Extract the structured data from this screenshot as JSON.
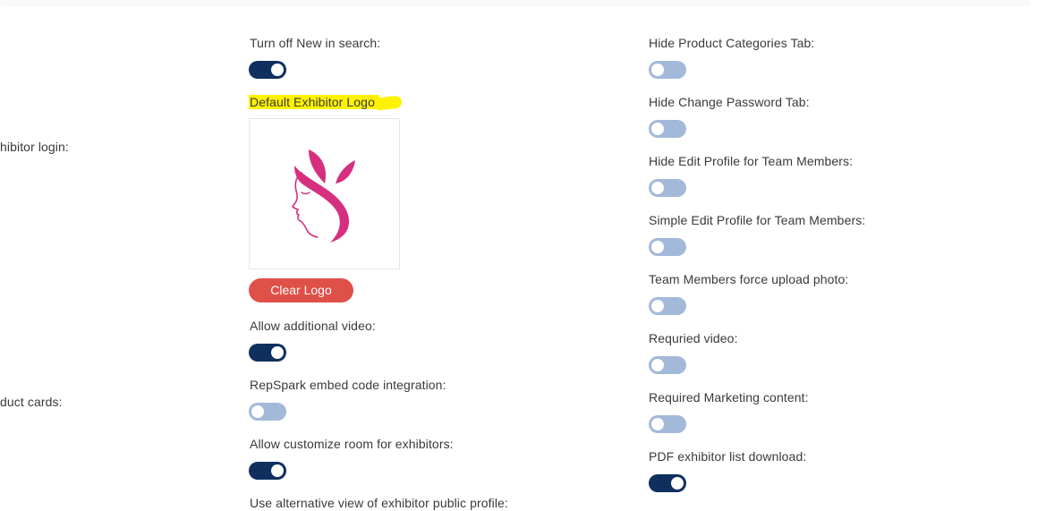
{
  "left_column": {
    "exhibitor_login_label": "hibitor login:",
    "product_cards_label": "duct cards:"
  },
  "middle_column": {
    "turn_off_new_label": "Turn off New in search:",
    "turn_off_new_on": true,
    "default_logo_label": "Default Exhibitor Logo:",
    "clear_logo_button": "Clear Logo",
    "allow_video_label": "Allow additional video:",
    "allow_video_on": true,
    "repspark_label": "RepSpark embed code integration:",
    "repspark_on": false,
    "customize_room_label": "Allow customize room for exhibitors:",
    "customize_room_on": true,
    "alt_view_label": "Use alternative view of exhibitor public profile:"
  },
  "right_column": {
    "hide_categories_label": "Hide Product Categories Tab:",
    "hide_categories_on": false,
    "hide_password_label": "Hide Change Password Tab:",
    "hide_password_on": false,
    "hide_edit_profile_label": "Hide Edit Profile for Team Members:",
    "hide_edit_profile_on": false,
    "simple_edit_profile_label": "Simple Edit Profile for Team Members:",
    "simple_edit_profile_on": false,
    "force_photo_label": "Team Members force upload photo:",
    "force_photo_on": false,
    "required_video_label": "Requried video:",
    "required_video_on": false,
    "required_marketing_label": "Required Marketing content:",
    "required_marketing_on": false,
    "pdf_download_label": "PDF exhibitor list download:",
    "pdf_download_on": true
  },
  "colors": {
    "toggle_on": "#0f2f5f",
    "toggle_off": "#a3b9d9",
    "clear_button": "#df5048",
    "logo_pink": "#d62f7f",
    "highlight": "#fff200"
  }
}
